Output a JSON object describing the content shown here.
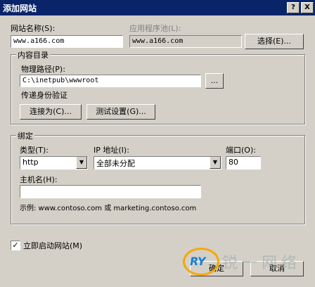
{
  "window": {
    "title": "添加网站",
    "help": "?",
    "close": "X"
  },
  "site_name": {
    "label": "网站名称(S):",
    "value": "www.a166.com"
  },
  "app_pool": {
    "label": "应用程序池(L):",
    "value": "www.a166.com",
    "select_label": "选择(E)..."
  },
  "content": {
    "legend": "内容目录",
    "path_label": "物理路径(P):",
    "path_value": "C:\\inetpub\\wwwroot",
    "browse_label": "...",
    "auth_label": "传递身份验证",
    "connect_as_label": "连接为(C)...",
    "test_settings_label": "测试设置(G)..."
  },
  "binding": {
    "legend": "绑定",
    "type_label": "类型(T):",
    "type_value": "http",
    "ip_label": "IP 地址(I):",
    "ip_value": "全部未分配",
    "port_label": "端口(O):",
    "port_value": "80",
    "host_label": "主机名(H):",
    "host_value": "",
    "example": "示例: www.contoso.com 或 marketing.contoso.com"
  },
  "start_site": {
    "label": "立即启动网站(M)",
    "checked": true
  },
  "footer": {
    "ok_label": "确定",
    "cancel_label": "取消"
  },
  "watermark": {
    "logo_text": "RY",
    "chinese": "锐一网络"
  }
}
